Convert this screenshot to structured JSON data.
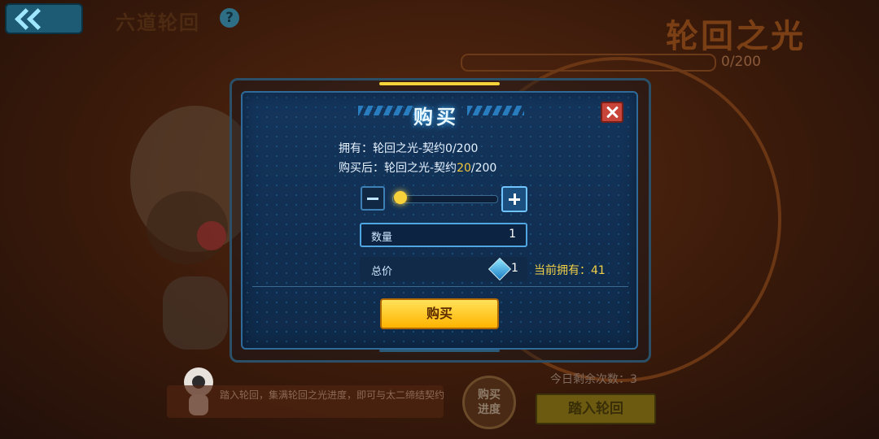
{
  "header": {
    "title": "六道轮回",
    "light_title": "轮回之光",
    "light_count": "0/200"
  },
  "modal": {
    "title": "购买",
    "owned_line": "拥有：轮回之光-契约0/200",
    "after_prefix": "购买后：轮回之光-契约",
    "after_value": "20",
    "after_suffix": "/200",
    "quantity_label": "数量",
    "quantity_value": "1",
    "total_label": "总价",
    "total_value": "1",
    "currently_owned": "当前拥有：41",
    "buy_label": "购买",
    "slider_fraction": 0.05
  },
  "bottom": {
    "tip": "踏入轮回，集满轮回之光进度，即可与太二缔结契约",
    "remaining": "今日剩余次数：3",
    "progress_button": "购买进度",
    "enter_button": "踏入轮回"
  },
  "colors": {
    "accent_yellow": "#f5c83a",
    "modal_blue": "#14355c",
    "close_red": "#c8453a"
  }
}
